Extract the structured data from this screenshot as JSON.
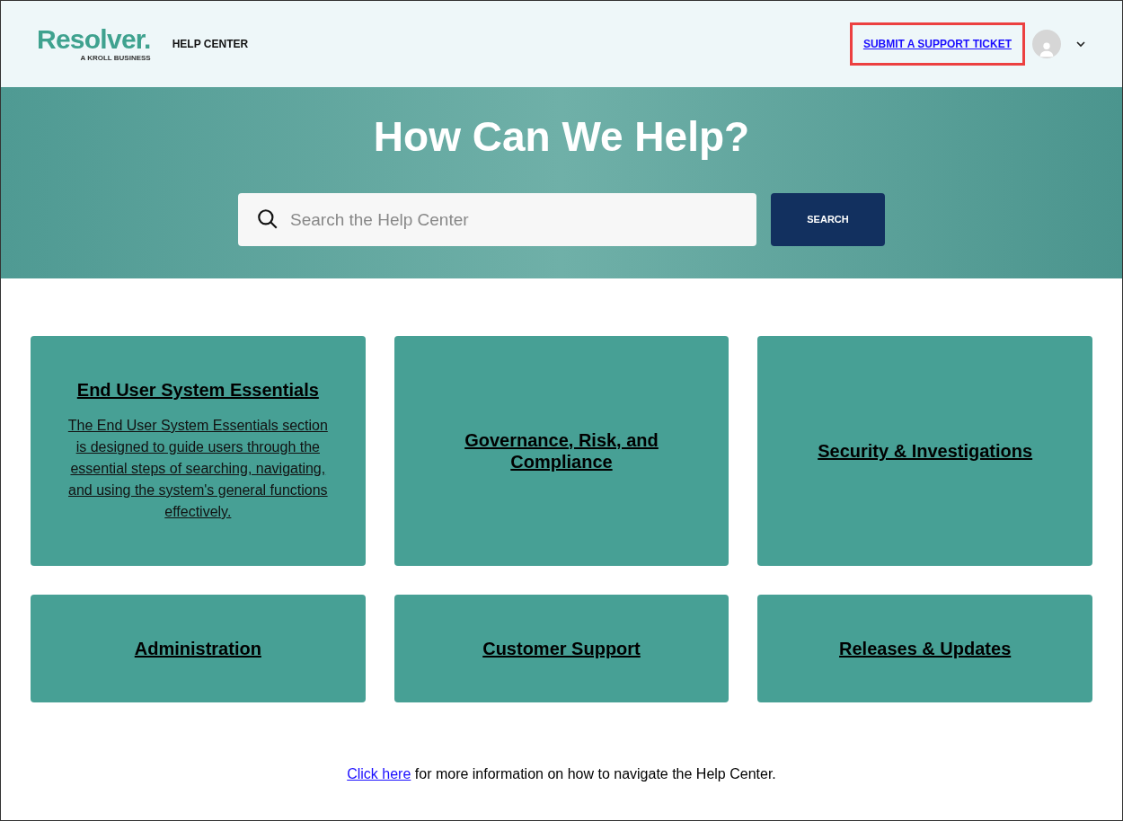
{
  "header": {
    "logo": {
      "name": "Resolver.",
      "tagline": "A KROLL BUSINESS"
    },
    "title": "HELP CENTER",
    "support_link": {
      "label": "SUBMIT A SUPPORT TICKET",
      "highlighted": true
    }
  },
  "hero": {
    "heading": "How Can We Help?",
    "search": {
      "placeholder": "Search the Help Center"
    },
    "search_button": "SEARCH"
  },
  "cards": [
    {
      "title": "End User System Essentials",
      "description": "The End User System Essentials section is designed to guide users through the essential steps of searching, navigating, and using the system's general functions effectively."
    },
    {
      "title": "Governance, Risk, and Compliance"
    },
    {
      "title": "Security & Investigations"
    },
    {
      "title": "Administration"
    },
    {
      "title": "Customer Support"
    },
    {
      "title": "Releases & Updates"
    }
  ],
  "footer": {
    "link": "Click here",
    "text": " for more information on how to navigate the Help Center."
  }
}
